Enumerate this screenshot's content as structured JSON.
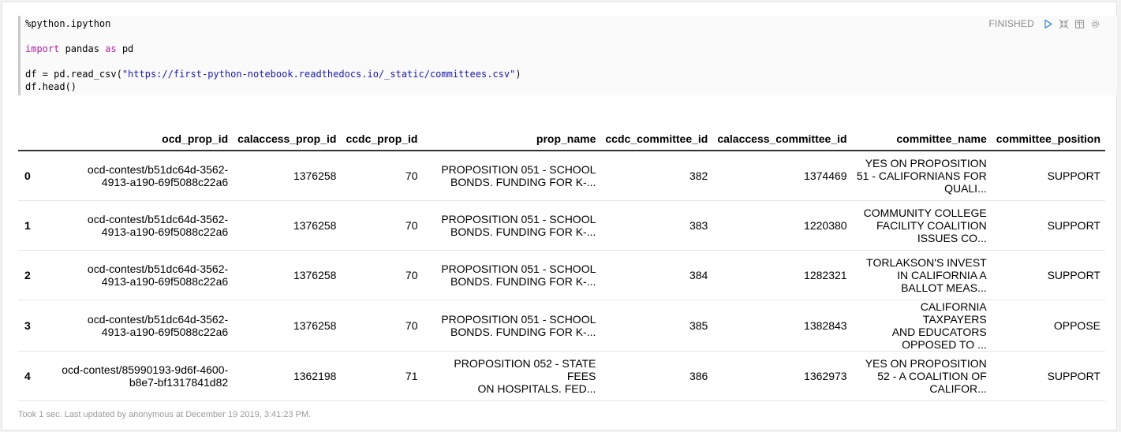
{
  "editor": {
    "lines": [
      {
        "segments": [
          {
            "text": "%python.ipython",
            "cls": ""
          }
        ]
      },
      {
        "segments": [
          {
            "text": "import",
            "cls": "kw"
          },
          {
            "text": " pandas ",
            "cls": ""
          },
          {
            "text": "as",
            "cls": "kw"
          },
          {
            "text": " pd",
            "cls": ""
          }
        ]
      },
      {
        "segments": [
          {
            "text": "df = pd.read_csv(",
            "cls": ""
          },
          {
            "text": "\"https://first-python-notebook.readthedocs.io/_static/committees.csv\"",
            "cls": "str"
          },
          {
            "text": ")",
            "cls": ""
          }
        ]
      },
      {
        "segments": [
          {
            "text": "df.head()",
            "cls": ""
          }
        ]
      }
    ]
  },
  "controls": {
    "status": "FINISHED",
    "icons": [
      "run-icon",
      "collapse-icon",
      "book-icon",
      "gear-icon"
    ]
  },
  "table": {
    "columns": [
      "",
      "ocd_prop_id",
      "calaccess_prop_id",
      "ccdc_prop_id",
      "prop_name",
      "ccdc_committee_id",
      "calaccess_committee_id",
      "committee_name",
      "committee_position"
    ],
    "rows": [
      [
        "0",
        "ocd-contest/b51dc64d-3562-\n4913-a190-69f5088c22a6",
        "1376258",
        "70",
        "PROPOSITION 051 - SCHOOL\nBONDS. FUNDING FOR K-...",
        "382",
        "1374469",
        "YES ON PROPOSITION\n51 - CALIFORNIANS FOR\nQUALI...",
        "SUPPORT"
      ],
      [
        "1",
        "ocd-contest/b51dc64d-3562-\n4913-a190-69f5088c22a6",
        "1376258",
        "70",
        "PROPOSITION 051 - SCHOOL\nBONDS. FUNDING FOR K-...",
        "383",
        "1220380",
        "COMMUNITY COLLEGE\nFACILITY COALITION\nISSUES CO...",
        "SUPPORT"
      ],
      [
        "2",
        "ocd-contest/b51dc64d-3562-\n4913-a190-69f5088c22a6",
        "1376258",
        "70",
        "PROPOSITION 051 - SCHOOL\nBONDS. FUNDING FOR K-...",
        "384",
        "1282321",
        "TORLAKSON'S INVEST\nIN CALIFORNIA A\nBALLOT MEAS...",
        "SUPPORT"
      ],
      [
        "3",
        "ocd-contest/b51dc64d-3562-\n4913-a190-69f5088c22a6",
        "1376258",
        "70",
        "PROPOSITION 051 - SCHOOL\nBONDS. FUNDING FOR K-...",
        "385",
        "1382843",
        "CALIFORNIA TAXPAYERS\nAND EDUCATORS\nOPPOSED TO ...",
        "OPPOSE"
      ],
      [
        "4",
        "ocd-contest/85990193-9d6f-4600-\nb8e7-bf1317841d82",
        "1362198",
        "71",
        "PROPOSITION 052 - STATE FEES\nON HOSPITALS. FED...",
        "386",
        "1362973",
        "YES ON PROPOSITION\n52 - A COALITION OF\nCALIFOR...",
        "SUPPORT"
      ]
    ]
  },
  "footer": {
    "text": "Took 1 sec. Last updated by anonymous at December 19 2019, 3:41:23 PM."
  },
  "colors": {
    "keyword": "#a626a4",
    "string": "#1a1aa6",
    "run_icon": "#4a90d9",
    "muted": "#9a9a9a"
  }
}
